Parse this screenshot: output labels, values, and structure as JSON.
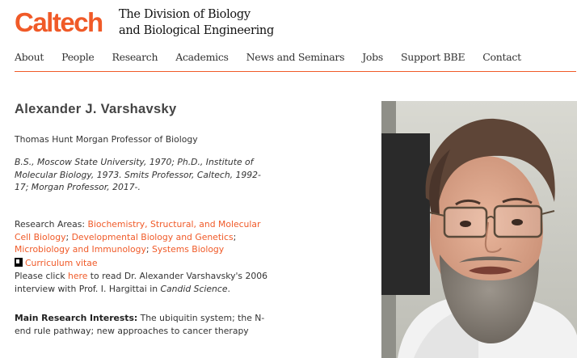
{
  "header": {
    "logo_text": "Caltech",
    "division_line1": "The Division of Biology",
    "division_line2": "and Biological Engineering"
  },
  "nav": {
    "items": [
      "About",
      "People",
      "Research",
      "Academics",
      "News and Seminars",
      "Jobs",
      "Support BBE",
      "Contact"
    ]
  },
  "profile": {
    "name": "Alexander J. Varshavsky",
    "title": "Thomas Hunt Morgan Professor of Biology",
    "education": "B.S., Moscow State University, 1970; Ph.D., Institute of Molecular Biology, 1973. Smits Professor, Caltech, 1992-17; Morgan Professor, 2017-.",
    "research_label": "Research Areas: ",
    "research_areas": [
      "Biochemistry, Structural, and Molecular Cell Biology",
      "Developmental Biology and Genetics",
      "Microbiology and Immunology",
      "Systems Biology"
    ],
    "research_sep": "; ",
    "cv_link": "Curriculum vitae",
    "interview_pre": "Please click ",
    "interview_link": "here",
    "interview_post": " to read Dr. Alexander Varshavsky's 2006 interview with Prof. I. Hargittai in ",
    "interview_book": "Candid Science",
    "interview_end": ".",
    "interests_label": "Main Research Interests:",
    "interests_text": "  The ubiquitin system;  the N-end rule pathway;  new approaches to cancer therapy"
  },
  "colors": {
    "accent": "#f05a28",
    "text": "#333333"
  },
  "icons": {
    "cv": "pdf-document-icon"
  }
}
